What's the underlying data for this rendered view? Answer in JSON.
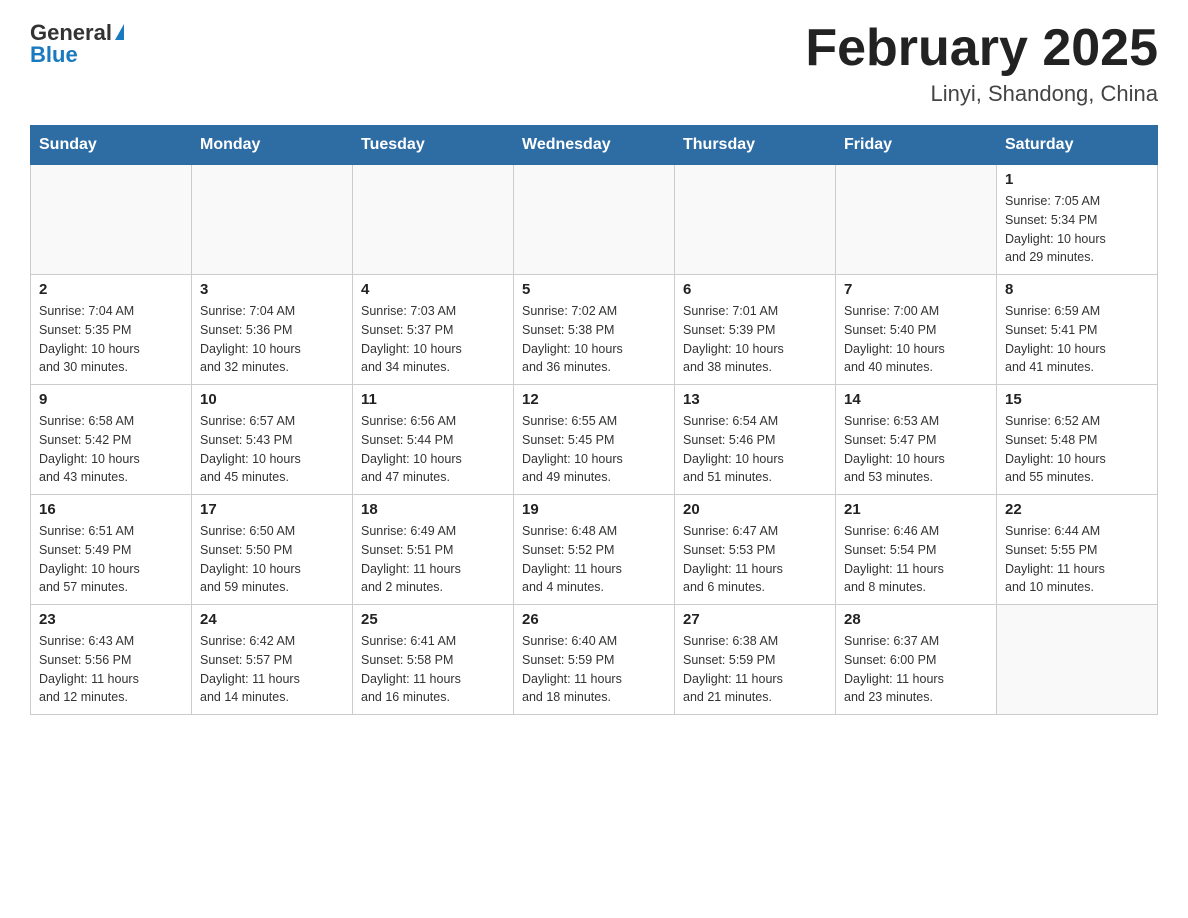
{
  "header": {
    "logo_general": "General",
    "logo_blue": "Blue",
    "title": "February 2025",
    "subtitle": "Linyi, Shandong, China"
  },
  "days_of_week": [
    "Sunday",
    "Monday",
    "Tuesday",
    "Wednesday",
    "Thursday",
    "Friday",
    "Saturday"
  ],
  "weeks": [
    [
      {
        "day": "",
        "info": ""
      },
      {
        "day": "",
        "info": ""
      },
      {
        "day": "",
        "info": ""
      },
      {
        "day": "",
        "info": ""
      },
      {
        "day": "",
        "info": ""
      },
      {
        "day": "",
        "info": ""
      },
      {
        "day": "1",
        "info": "Sunrise: 7:05 AM\nSunset: 5:34 PM\nDaylight: 10 hours\nand 29 minutes."
      }
    ],
    [
      {
        "day": "2",
        "info": "Sunrise: 7:04 AM\nSunset: 5:35 PM\nDaylight: 10 hours\nand 30 minutes."
      },
      {
        "day": "3",
        "info": "Sunrise: 7:04 AM\nSunset: 5:36 PM\nDaylight: 10 hours\nand 32 minutes."
      },
      {
        "day": "4",
        "info": "Sunrise: 7:03 AM\nSunset: 5:37 PM\nDaylight: 10 hours\nand 34 minutes."
      },
      {
        "day": "5",
        "info": "Sunrise: 7:02 AM\nSunset: 5:38 PM\nDaylight: 10 hours\nand 36 minutes."
      },
      {
        "day": "6",
        "info": "Sunrise: 7:01 AM\nSunset: 5:39 PM\nDaylight: 10 hours\nand 38 minutes."
      },
      {
        "day": "7",
        "info": "Sunrise: 7:00 AM\nSunset: 5:40 PM\nDaylight: 10 hours\nand 40 minutes."
      },
      {
        "day": "8",
        "info": "Sunrise: 6:59 AM\nSunset: 5:41 PM\nDaylight: 10 hours\nand 41 minutes."
      }
    ],
    [
      {
        "day": "9",
        "info": "Sunrise: 6:58 AM\nSunset: 5:42 PM\nDaylight: 10 hours\nand 43 minutes."
      },
      {
        "day": "10",
        "info": "Sunrise: 6:57 AM\nSunset: 5:43 PM\nDaylight: 10 hours\nand 45 minutes."
      },
      {
        "day": "11",
        "info": "Sunrise: 6:56 AM\nSunset: 5:44 PM\nDaylight: 10 hours\nand 47 minutes."
      },
      {
        "day": "12",
        "info": "Sunrise: 6:55 AM\nSunset: 5:45 PM\nDaylight: 10 hours\nand 49 minutes."
      },
      {
        "day": "13",
        "info": "Sunrise: 6:54 AM\nSunset: 5:46 PM\nDaylight: 10 hours\nand 51 minutes."
      },
      {
        "day": "14",
        "info": "Sunrise: 6:53 AM\nSunset: 5:47 PM\nDaylight: 10 hours\nand 53 minutes."
      },
      {
        "day": "15",
        "info": "Sunrise: 6:52 AM\nSunset: 5:48 PM\nDaylight: 10 hours\nand 55 minutes."
      }
    ],
    [
      {
        "day": "16",
        "info": "Sunrise: 6:51 AM\nSunset: 5:49 PM\nDaylight: 10 hours\nand 57 minutes."
      },
      {
        "day": "17",
        "info": "Sunrise: 6:50 AM\nSunset: 5:50 PM\nDaylight: 10 hours\nand 59 minutes."
      },
      {
        "day": "18",
        "info": "Sunrise: 6:49 AM\nSunset: 5:51 PM\nDaylight: 11 hours\nand 2 minutes."
      },
      {
        "day": "19",
        "info": "Sunrise: 6:48 AM\nSunset: 5:52 PM\nDaylight: 11 hours\nand 4 minutes."
      },
      {
        "day": "20",
        "info": "Sunrise: 6:47 AM\nSunset: 5:53 PM\nDaylight: 11 hours\nand 6 minutes."
      },
      {
        "day": "21",
        "info": "Sunrise: 6:46 AM\nSunset: 5:54 PM\nDaylight: 11 hours\nand 8 minutes."
      },
      {
        "day": "22",
        "info": "Sunrise: 6:44 AM\nSunset: 5:55 PM\nDaylight: 11 hours\nand 10 minutes."
      }
    ],
    [
      {
        "day": "23",
        "info": "Sunrise: 6:43 AM\nSunset: 5:56 PM\nDaylight: 11 hours\nand 12 minutes."
      },
      {
        "day": "24",
        "info": "Sunrise: 6:42 AM\nSunset: 5:57 PM\nDaylight: 11 hours\nand 14 minutes."
      },
      {
        "day": "25",
        "info": "Sunrise: 6:41 AM\nSunset: 5:58 PM\nDaylight: 11 hours\nand 16 minutes."
      },
      {
        "day": "26",
        "info": "Sunrise: 6:40 AM\nSunset: 5:59 PM\nDaylight: 11 hours\nand 18 minutes."
      },
      {
        "day": "27",
        "info": "Sunrise: 6:38 AM\nSunset: 5:59 PM\nDaylight: 11 hours\nand 21 minutes."
      },
      {
        "day": "28",
        "info": "Sunrise: 6:37 AM\nSunset: 6:00 PM\nDaylight: 11 hours\nand 23 minutes."
      },
      {
        "day": "",
        "info": ""
      }
    ]
  ]
}
